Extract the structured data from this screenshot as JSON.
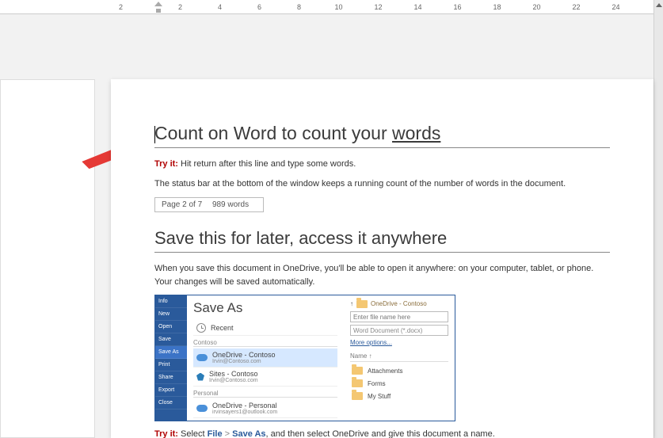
{
  "ruler": {
    "ticks": [
      "2",
      "",
      "",
      "2",
      "",
      "4",
      "",
      "6",
      "",
      "8",
      "",
      "10",
      "",
      "12",
      "",
      "14",
      "",
      "16",
      "",
      "18",
      "",
      "20",
      "",
      "22",
      "",
      "24",
      ""
    ]
  },
  "section1": {
    "heading_prefix": "Count on Word to count your ",
    "heading_underlined": "words",
    "tryit_label": "Try it:",
    "tryit_text": " Hit return after this line and type some words.",
    "status_desc": "The status bar at the bottom of the window keeps a running count of the number of words in the document.",
    "statusbox_page": "Page 2 of 7",
    "statusbox_words": "989 words"
  },
  "section2": {
    "heading": "Save this for later, access it anywhere",
    "intro": "When you save this document in OneDrive, you'll be able to open it anywhere: on your computer, tablet, or phone. Your changes will be saved automatically.",
    "tryit_label": "Try it:",
    "tryit_pre": " Select ",
    "tryit_file": "File",
    "tryit_sep": " > ",
    "tryit_saveas": "Save As",
    "tryit_post": ", and then select OneDrive and give this document a name."
  },
  "saveas": {
    "menu": [
      "Info",
      "New",
      "Open",
      "Save",
      "Save As",
      "Print",
      "Share",
      "Export",
      "Close"
    ],
    "menu_selected": "Save As",
    "title": "Save As",
    "recent": "Recent",
    "group_contoso": "Contoso",
    "onedrive_contoso": "OneDrive - Contoso",
    "onedrive_contoso_sub": "Irvin@Contoso.com",
    "sites_contoso": "Sites - Contoso",
    "sites_contoso_sub": "Irvin@Contoso.com",
    "group_personal": "Personal",
    "onedrive_personal": "OneDrive - Personal",
    "onedrive_personal_sub": "irvinsayers1@outlook.com",
    "crumb": "OneDrive - Contoso",
    "filename_placeholder": "Enter file name here",
    "filetype": "Word Document (*.docx)",
    "more_options": "More options...",
    "name_header": "Name ↑",
    "folders": [
      "Attachments",
      "Forms",
      "My Stuff"
    ]
  }
}
